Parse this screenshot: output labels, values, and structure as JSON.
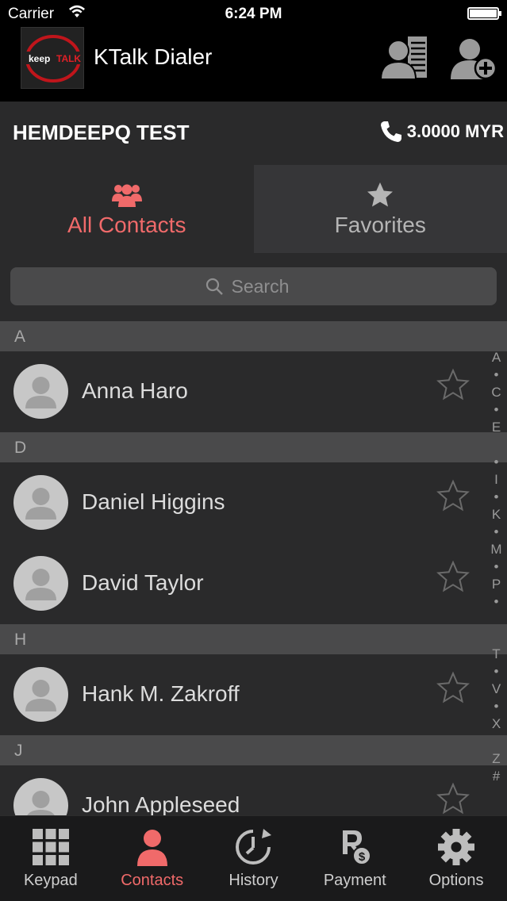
{
  "status": {
    "carrier": "Carrier",
    "time": "6:24 PM"
  },
  "header": {
    "logo_text_1": "keep",
    "logo_text_2": "TALK",
    "title": "KTalk Dialer"
  },
  "account": {
    "name": "HEMDEEPQ TEST",
    "balance": "3.0000 MYR"
  },
  "tabs": [
    {
      "label": "All Contacts",
      "active": true
    },
    {
      "label": "Favorites",
      "active": false
    }
  ],
  "search": {
    "placeholder": "Search"
  },
  "sections": [
    {
      "letter": "A",
      "contacts": [
        "Anna Haro"
      ]
    },
    {
      "letter": "D",
      "contacts": [
        "Daniel Higgins",
        "David Taylor"
      ]
    },
    {
      "letter": "H",
      "contacts": [
        "Hank M. Zakroff"
      ]
    },
    {
      "letter": "J",
      "contacts": [
        "John Appleseed"
      ]
    }
  ],
  "index": [
    "A",
    "•",
    "C",
    "•",
    "E",
    "",
    "•",
    "I",
    "•",
    "K",
    "•",
    "M",
    "•",
    "P",
    "•",
    "",
    "",
    "T",
    "•",
    "V",
    "•",
    "X",
    "",
    "Z",
    "#"
  ],
  "bottom_tabs": [
    {
      "label": "Keypad",
      "icon": "keypad-icon"
    },
    {
      "label": "Contacts",
      "icon": "contacts-icon",
      "active": true
    },
    {
      "label": "History",
      "icon": "history-icon"
    },
    {
      "label": "Payment",
      "icon": "payment-icon"
    },
    {
      "label": "Options",
      "icon": "gear-icon"
    }
  ],
  "colors": {
    "accent": "#f06a6a",
    "background": "#2a2a2b",
    "section": "#4a4a4b"
  }
}
